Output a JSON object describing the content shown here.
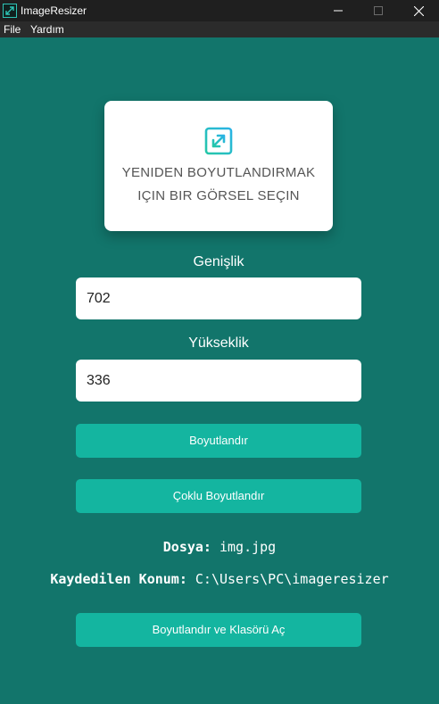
{
  "window": {
    "title": "ImageResizer"
  },
  "menu": {
    "file": "File",
    "help": "Yardım"
  },
  "select_card": {
    "line1": "YENIDEN BOYUTLANDIRMAK",
    "line2": "IÇIN BIR GÖRSEL SEÇIN",
    "icon": "resize-expand-icon"
  },
  "width": {
    "label": "Genişlik",
    "value": "702"
  },
  "height": {
    "label": "Yükseklik",
    "value": "336"
  },
  "buttons": {
    "resize": "Boyutlandır",
    "multi_resize": "Çoklu Boyutlandır",
    "resize_open": "Boyutlandır ve Klasörü Aç"
  },
  "info": {
    "file_label": "Dosya:",
    "file_value": "img.jpg",
    "location_label": "Kaydedilen Konum:",
    "location_value": "C:\\Users\\PC\\imageresizer"
  },
  "colors": {
    "background": "#12756b",
    "button": "#14b5a0",
    "titlebar": "#1f1f1f",
    "menubar": "#2b2b2b"
  }
}
